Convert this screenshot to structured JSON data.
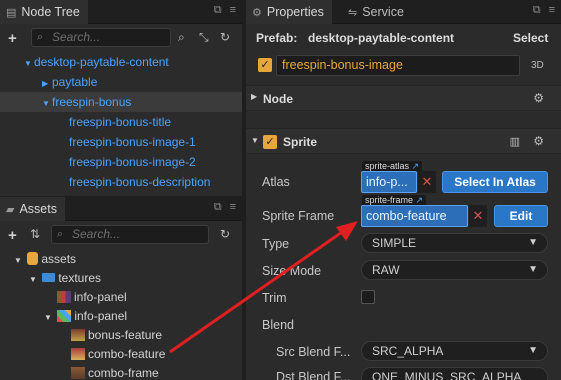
{
  "nodeTree": {
    "title": "Node Tree",
    "searchPlaceholder": "Search...",
    "items": [
      {
        "label": "desktop-paytable-content"
      },
      {
        "label": "paytable"
      },
      {
        "label": "freespin-bonus"
      },
      {
        "label": "freespin-bonus-title"
      },
      {
        "label": "freespin-bonus-image-1"
      },
      {
        "label": "freespin-bonus-image-2"
      },
      {
        "label": "freespin-bonus-description"
      }
    ]
  },
  "assets": {
    "title": "Assets",
    "searchPlaceholder": "Search...",
    "items": [
      {
        "label": "assets"
      },
      {
        "label": "textures"
      },
      {
        "label": "info-panel"
      },
      {
        "label": "info-panel"
      },
      {
        "label": "bonus-feature"
      },
      {
        "label": "combo-feature"
      },
      {
        "label": "combo-frame"
      }
    ]
  },
  "properties": {
    "tabs": [
      {
        "label": "Properties"
      },
      {
        "label": "Service"
      }
    ],
    "prefabLabel": "Prefab:",
    "prefabName": "desktop-paytable-content",
    "selectLabel": "Select",
    "nodeName": "freespin-bonus-image",
    "badge3d": "3D",
    "nodeSection": "Node",
    "spriteSection": "Sprite",
    "atlas": {
      "label": "Atlas",
      "tag": "sprite-atlas",
      "value": "info-p...",
      "button": "Select In Atlas"
    },
    "spriteFrame": {
      "label": "Sprite Frame",
      "tag": "sprite-frame",
      "value": "combo-feature",
      "button": "Edit"
    },
    "type": {
      "label": "Type",
      "value": "SIMPLE"
    },
    "sizeMode": {
      "label": "Size Mode",
      "value": "RAW"
    },
    "trim": {
      "label": "Trim"
    },
    "blend": {
      "label": "Blend"
    },
    "srcBlend": {
      "label": "Src Blend F...",
      "value": "SRC_ALPHA"
    },
    "dstBlend": {
      "label": "Dst Blend F...",
      "value": "ONE_MINUS_SRC_ALPHA"
    }
  },
  "colors": {
    "accentBlue": "#4aa3ff",
    "checkboxOrange": "#e8a73c",
    "arrowRed": "#e02020"
  }
}
